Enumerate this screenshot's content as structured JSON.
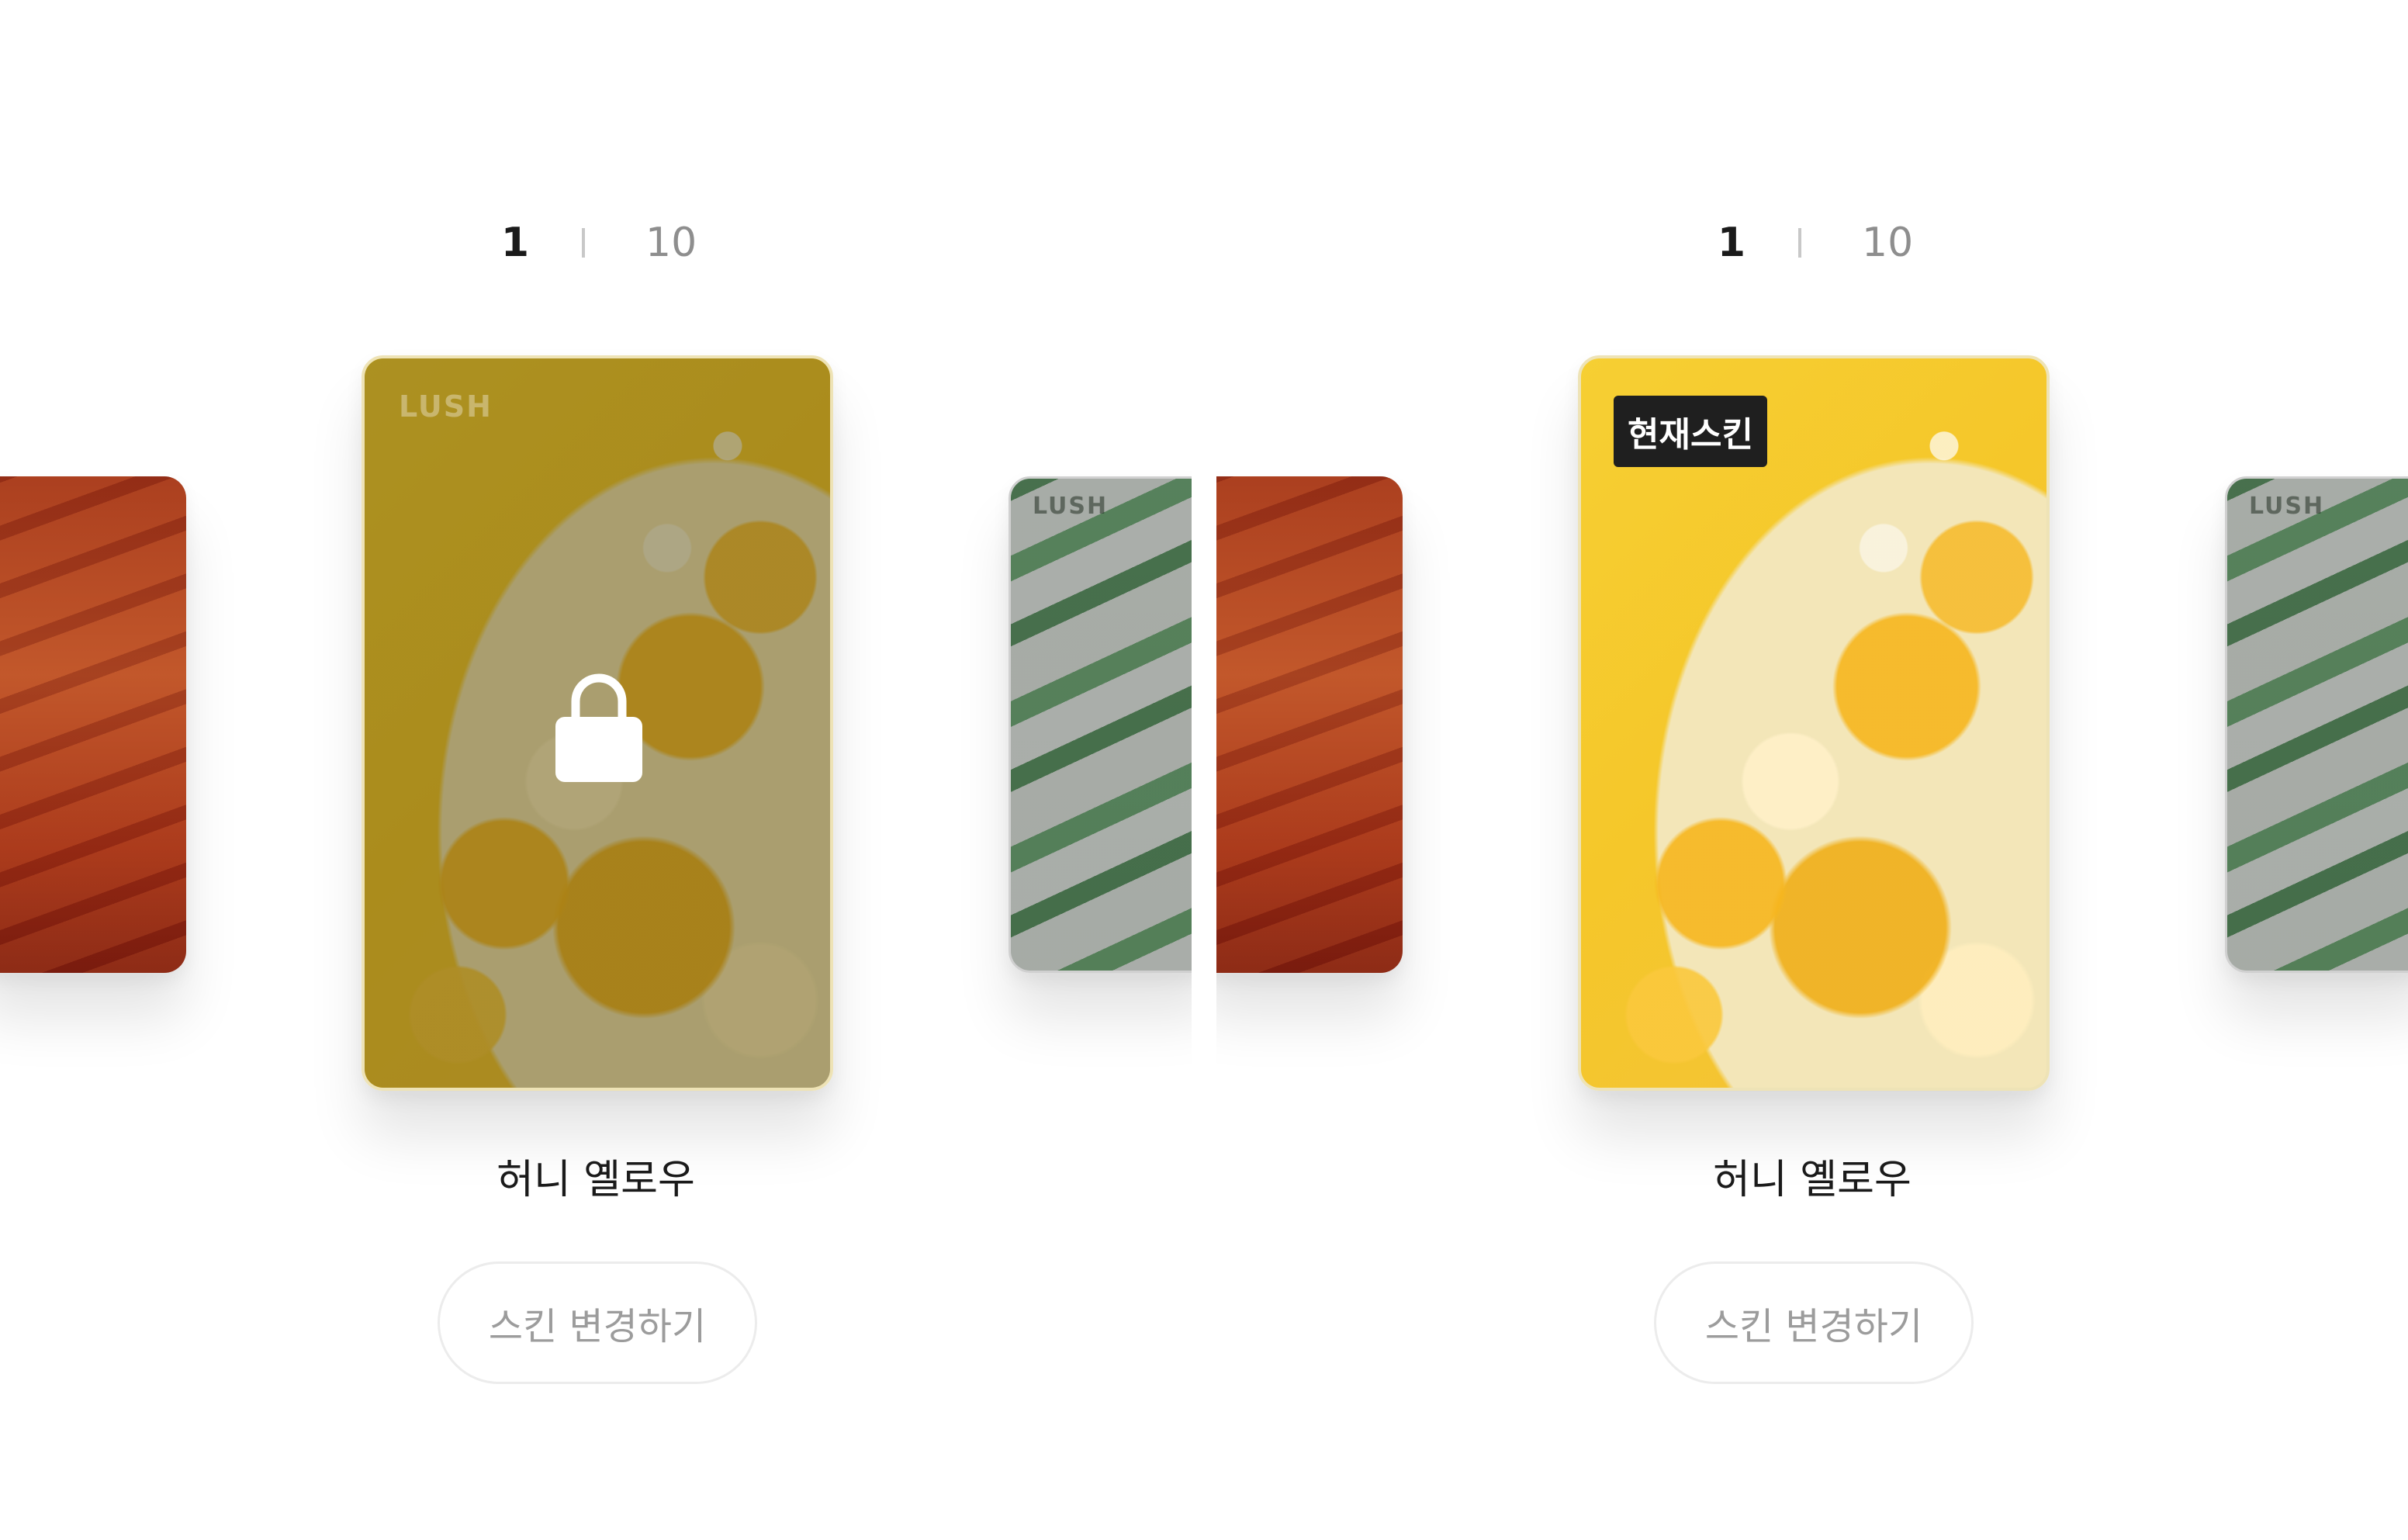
{
  "panels": [
    {
      "id": "left",
      "counter": {
        "current": "1",
        "total": "10"
      },
      "card": {
        "brand": "LUSH",
        "locked": true,
        "icon": "lock-icon"
      },
      "prev_card_brand": "",
      "next_card_brand": "LUSH",
      "skin_name": "허니 옐로우",
      "change_button_label": "스킨 변경하기"
    },
    {
      "id": "right",
      "counter": {
        "current": "1",
        "total": "10"
      },
      "card": {
        "badge": "현재스킨",
        "locked": false
      },
      "next_card_brand": "LUSH",
      "skin_name": "허니 옐로우",
      "change_button_label": "스킨 변경하기"
    }
  ],
  "colors": {
    "honey_yellow": "#f6cf33",
    "badge_bg": "#1f1f1f",
    "button_text": "#9c9c9c",
    "counter_muted": "#8e8e8e"
  }
}
